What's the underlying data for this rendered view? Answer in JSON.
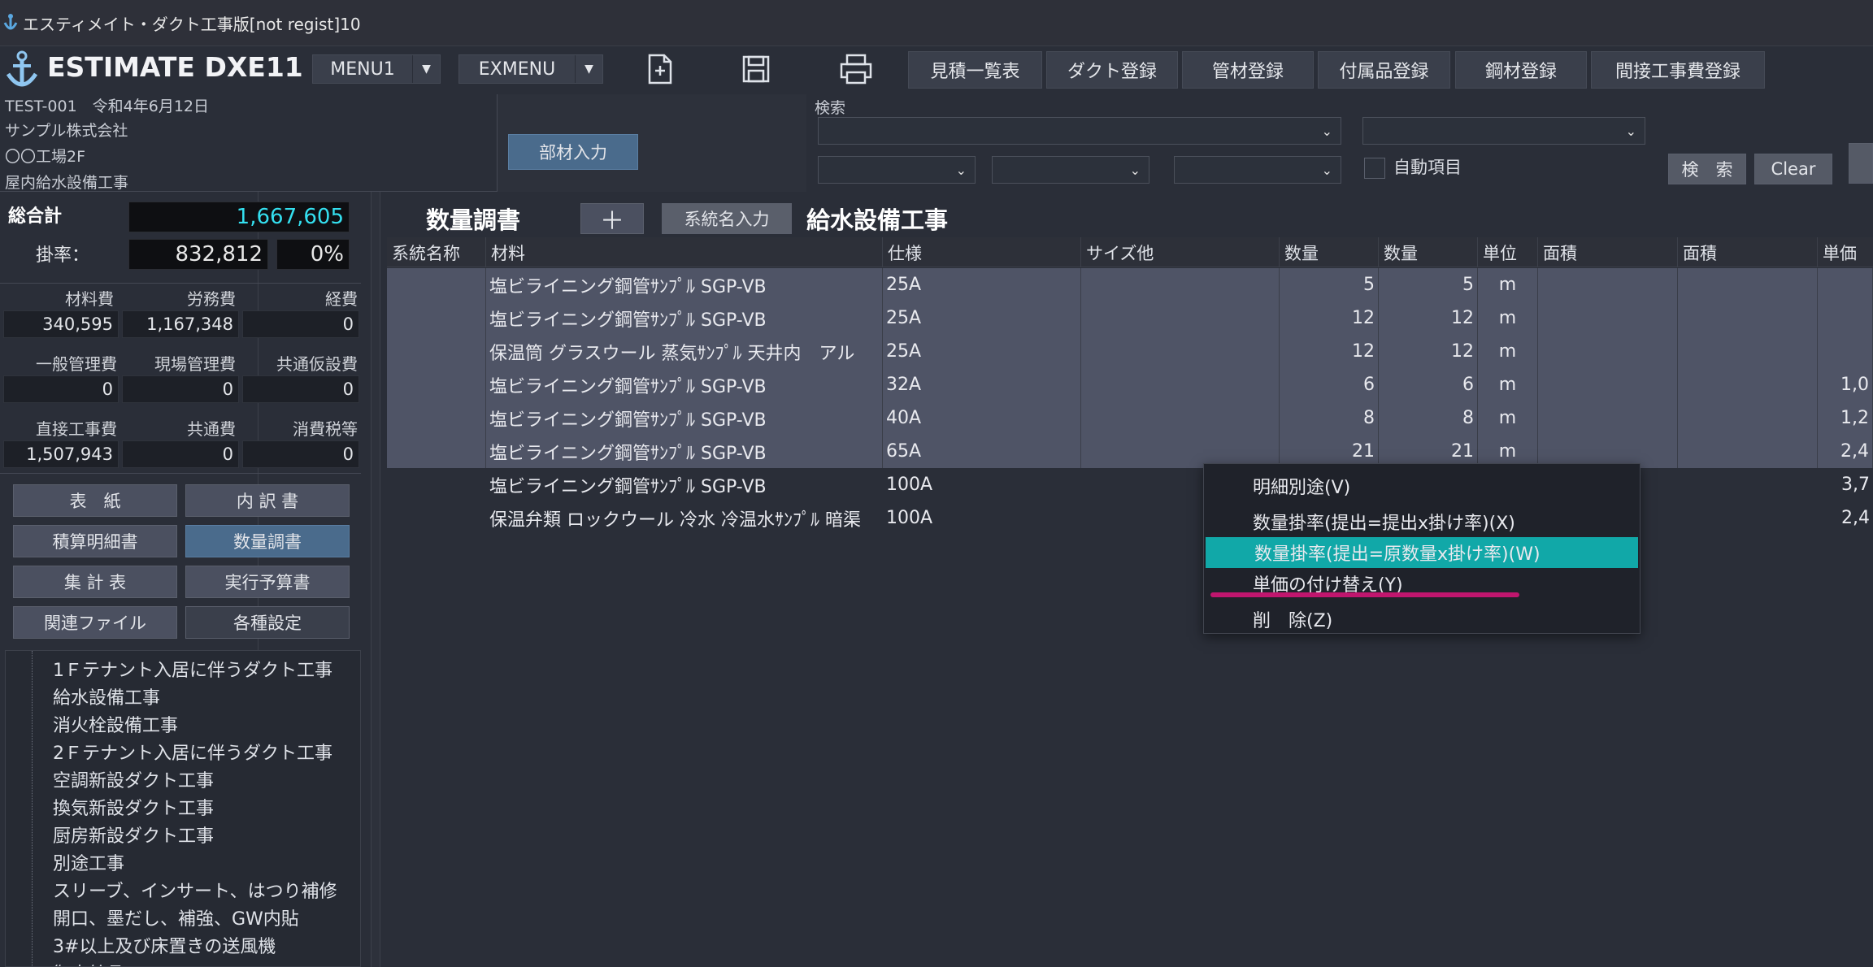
{
  "window": {
    "title": "エスティメイト・ダクト工事版[not regist]10"
  },
  "app": {
    "name": "ESTIMATE DXE11",
    "menu1": "MENU1",
    "exmenu": "EXMENU"
  },
  "toolbar": {
    "buttons": [
      "見積一覧表",
      "ダクト登録",
      "管材登録",
      "付属品登録",
      "鋼材登録",
      "間接工事費登録"
    ]
  },
  "project": {
    "code_date": "TEST-001　令和4年6月12日",
    "company": "サンプル株式会社",
    "site": "〇〇工場2F",
    "work": "屋内給水設備工事"
  },
  "search": {
    "label": "検索",
    "auto_label": "自動項目",
    "search_btn": "検　索",
    "clear_btn": "Clear",
    "input_btn": "部材入力"
  },
  "totals": {
    "total_label": "総合計",
    "total": "1,667,605",
    "rate_label": "掛率：",
    "rate_value": "832,812",
    "rate_pct": "0%"
  },
  "costs": [
    {
      "label": "材料費",
      "value": "340,595"
    },
    {
      "label": "労務費",
      "value": "1,167,348"
    },
    {
      "label": "経費",
      "value": "0"
    },
    {
      "label": "一般管理費",
      "value": "0"
    },
    {
      "label": "現場管理費",
      "value": "0"
    },
    {
      "label": "共通仮設費",
      "value": "0"
    },
    {
      "label": "直接工事費",
      "value": "1,507,943"
    },
    {
      "label": "共通費",
      "value": "0"
    },
    {
      "label": "消費税等",
      "value": "0"
    }
  ],
  "navbuttons": [
    "表　紙",
    "内 訳 書",
    "積算明細書",
    "数量調書",
    "集 計 表",
    "実行予算書",
    "関連ファイル",
    "各種設定"
  ],
  "tree": [
    "1Ｆテナント入居に伴うダクト工事",
    "給水設備工事",
    "消火栓設備工事",
    "2Ｆテナント入居に伴うダクト工事",
    "空調新設ダクト工事",
    "換気新設ダクト工事",
    "厨房新設ダクト工事",
    "別途工事",
    "スリーブ、インサート、はつり補修",
    "開口、墨だし、補強、GW内貼",
    "3#以上及び床置きの送風機",
    "御支給品"
  ],
  "sheet": {
    "title": "数量調書",
    "plus": "＋",
    "system_btn": "系統名入力",
    "work_title": "給水設備工事"
  },
  "columns": [
    "系統名称",
    "材料",
    "仕様",
    "サイズ他",
    "数量",
    "数量",
    "単位",
    "面積",
    "面積",
    "単価"
  ],
  "rows": [
    {
      "mat": "塩ビライニング鋼管ｻﾝﾌﾟﾙ SGP-VB",
      "spec": "25A",
      "q1": "5",
      "q2": "5",
      "unit": "m",
      "price": ""
    },
    {
      "mat": "塩ビライニング鋼管ｻﾝﾌﾟﾙ SGP-VB",
      "spec": "25A",
      "q1": "12",
      "q2": "12",
      "unit": "m",
      "price": ""
    },
    {
      "mat": "保温筒 グラスウール 蒸気ｻﾝﾌﾟﾙ 天井内　アル",
      "spec": "25A",
      "q1": "12",
      "q2": "12",
      "unit": "m",
      "price": ""
    },
    {
      "mat": "塩ビライニング鋼管ｻﾝﾌﾟﾙ SGP-VB",
      "spec": "32A",
      "q1": "6",
      "q2": "6",
      "unit": "m",
      "price": "1,0"
    },
    {
      "mat": "塩ビライニング鋼管ｻﾝﾌﾟﾙ SGP-VB",
      "spec": "40A",
      "q1": "8",
      "q2": "8",
      "unit": "m",
      "price": "1,2"
    },
    {
      "mat": "塩ビライニング鋼管ｻﾝﾌﾟﾙ SGP-VB",
      "spec": "65A",
      "q1": "21",
      "q2": "21",
      "unit": "m",
      "price": "2,4"
    },
    {
      "mat": "塩ビライニング鋼管ｻﾝﾌﾟﾙ SGP-VB",
      "spec": "100A",
      "q1": "",
      "q2": "",
      "unit": "",
      "price": "3,7"
    },
    {
      "mat": "保温弁類 ロックウール 冷水 冷温水ｻﾝﾌﾟﾙ 暗渠",
      "spec": "100A",
      "q1": "",
      "q2": "",
      "unit": "",
      "price": "2,4"
    }
  ],
  "context_menu": [
    "明細別途(V)",
    "数量掛率(提出=提出x掛け率)(X)",
    "数量掛率(提出=原数量x掛け率)(W)",
    "単価の付け替え(Y)",
    "削　除(Z)"
  ],
  "colors": {
    "accent_teal": "#11a8a8",
    "total_cyan": "#34e0f0",
    "underline": "#c0166e"
  }
}
